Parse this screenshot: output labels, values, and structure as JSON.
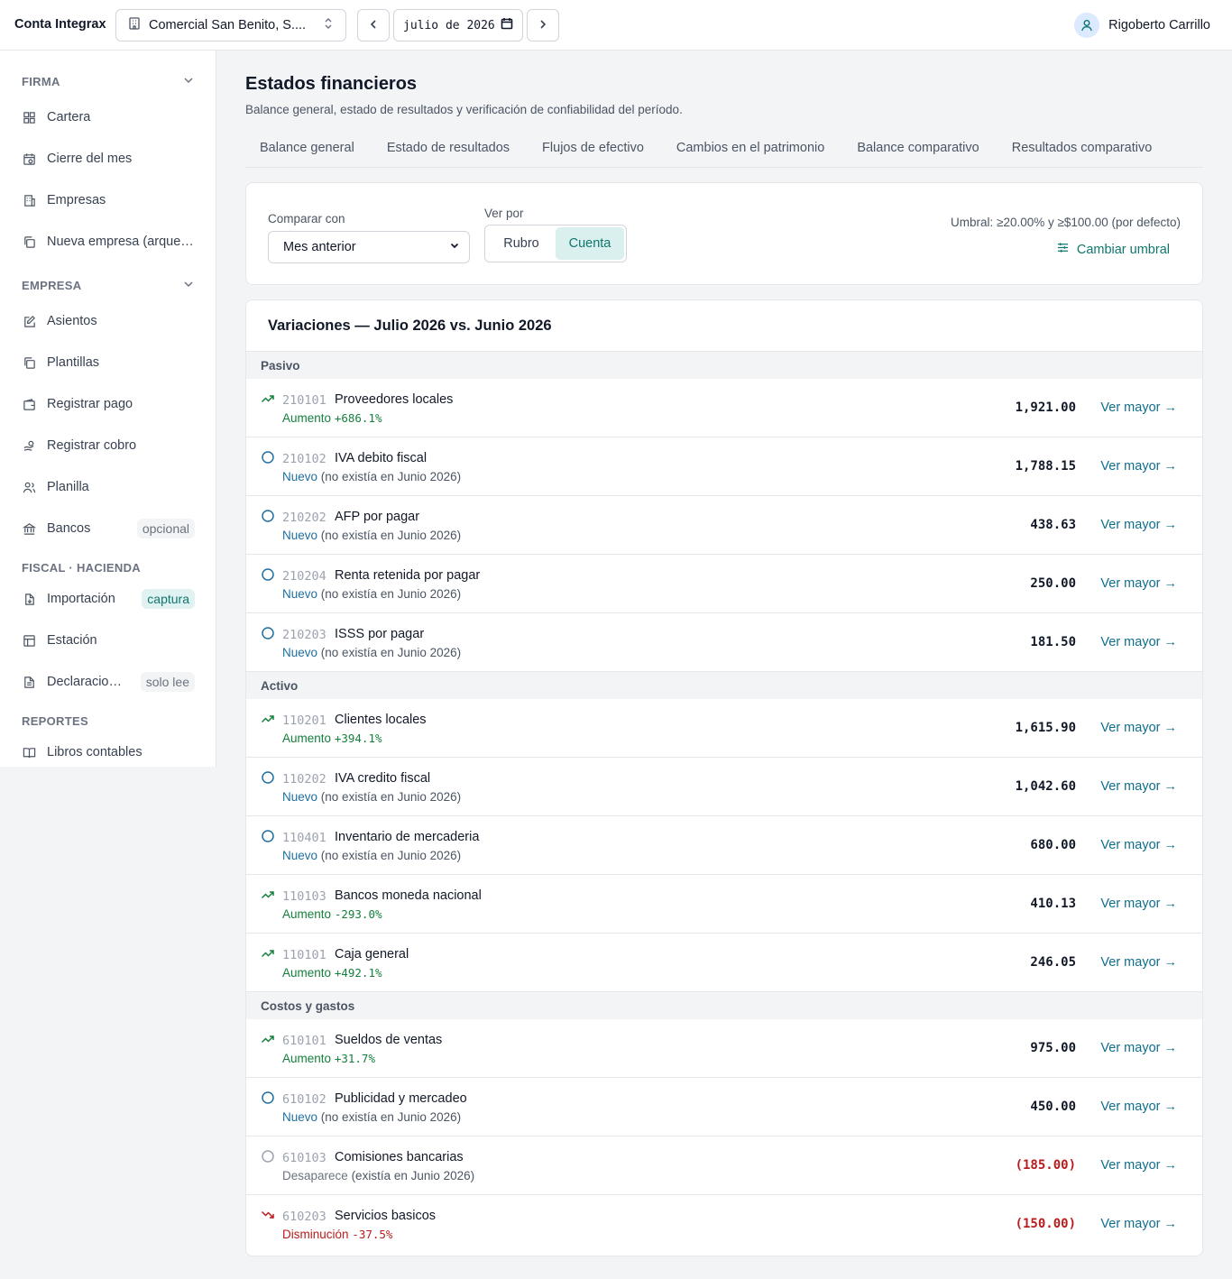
{
  "app": {
    "brand": "Conta Integrax"
  },
  "header": {
    "company": "Comercial San Benito, S....",
    "month_value": "julio de 2026",
    "user_name": "Rigoberto Carrillo"
  },
  "sidebar": {
    "sections": [
      {
        "title": "FIRMA",
        "items": [
          {
            "label": "Cartera",
            "icon": "grid-icon"
          },
          {
            "label": "Cierre del mes",
            "icon": "calendar-clock-icon"
          },
          {
            "label": "Empresas",
            "icon": "buildings-icon"
          },
          {
            "label": "Nueva empresa (arque…",
            "icon": "copy-icon"
          }
        ]
      },
      {
        "title": "EMPRESA",
        "items": [
          {
            "label": "Asientos",
            "icon": "edit-icon"
          },
          {
            "label": "Plantillas",
            "icon": "copy-icon"
          },
          {
            "label": "Registrar pago",
            "icon": "wallet-icon"
          },
          {
            "label": "Registrar cobro",
            "icon": "hand-coins-icon"
          },
          {
            "label": "Planilla",
            "icon": "users-icon"
          },
          {
            "label": "Bancos",
            "icon": "bank-icon",
            "badge": "opcional"
          }
        ]
      },
      {
        "title": "FISCAL · HACIENDA",
        "items": [
          {
            "label": "Importación",
            "icon": "file-import-icon",
            "badge": "captura"
          },
          {
            "label": "Estación",
            "icon": "table-icon"
          },
          {
            "label": "Declaracio…",
            "icon": "file-text-icon",
            "badge": "solo lee"
          }
        ]
      },
      {
        "title": "REPORTES",
        "items": [
          {
            "label": "Libros contables",
            "icon": "book-icon"
          }
        ]
      }
    ]
  },
  "page": {
    "title": "Estados financieros",
    "subtitle": "Balance general, estado de resultados y verificación de confiabilidad del período.",
    "tabs": [
      "Balance general",
      "Estado de resultados",
      "Flujos de efectivo",
      "Cambios en el patrimonio",
      "Balance comparativo",
      "Resultados comparativo"
    ]
  },
  "filters": {
    "compare_label": "Comparar con",
    "compare_value": "Mes anterior",
    "view_label": "Ver por",
    "view_options": [
      "Rubro",
      "Cuenta"
    ],
    "view_selected": "Cuenta",
    "threshold_text": "Umbral: ≥20.00% y ≥$100.00 (por defecto)",
    "threshold_button": "Cambiar umbral"
  },
  "variations": {
    "title": "Variaciones — Julio 2026 vs. Junio 2026",
    "link_label": "Ver mayor →",
    "groups": [
      {
        "name": "Pasivo",
        "rows": [
          {
            "code": "210101",
            "name": "Proveedores locales",
            "kind": "Aumento",
            "pct": "+686.1%",
            "amount": "1,921.00"
          },
          {
            "code": "210102",
            "name": "IVA debito fiscal",
            "kind": "Nuevo",
            "rest": "(no existía en Junio 2026)",
            "amount": "1,788.15"
          },
          {
            "code": "210202",
            "name": "AFP por pagar",
            "kind": "Nuevo",
            "rest": "(no existía en Junio 2026)",
            "amount": "438.63"
          },
          {
            "code": "210204",
            "name": "Renta retenida por pagar",
            "kind": "Nuevo",
            "rest": "(no existía en Junio 2026)",
            "amount": "250.00"
          },
          {
            "code": "210203",
            "name": "ISSS por pagar",
            "kind": "Nuevo",
            "rest": "(no existía en Junio 2026)",
            "amount": "181.50"
          }
        ]
      },
      {
        "name": "Activo",
        "rows": [
          {
            "code": "110201",
            "name": "Clientes locales",
            "kind": "Aumento",
            "pct": "+394.1%",
            "amount": "1,615.90"
          },
          {
            "code": "110202",
            "name": "IVA credito fiscal",
            "kind": "Nuevo",
            "rest": "(no existía en Junio 2026)",
            "amount": "1,042.60"
          },
          {
            "code": "110401",
            "name": "Inventario de mercaderia",
            "kind": "Nuevo",
            "rest": "(no existía en Junio 2026)",
            "amount": "680.00"
          },
          {
            "code": "110103",
            "name": "Bancos moneda nacional",
            "kind": "Aumento",
            "pct": "-293.0%",
            "amount": "410.13"
          },
          {
            "code": "110101",
            "name": "Caja general",
            "kind": "Aumento",
            "pct": "+492.1%",
            "amount": "246.05"
          }
        ]
      },
      {
        "name": "Costos y gastos",
        "rows": [
          {
            "code": "610101",
            "name": "Sueldos de ventas",
            "kind": "Aumento",
            "pct": "+31.7%",
            "amount": "975.00"
          },
          {
            "code": "610102",
            "name": "Publicidad y mercadeo",
            "kind": "Nuevo",
            "rest": "(no existía en Junio 2026)",
            "amount": "450.00"
          },
          {
            "code": "610103",
            "name": "Comisiones bancarias",
            "kind": "Desaparece",
            "rest": "(existía en Junio 2026)",
            "amount": "(185.00)"
          },
          {
            "code": "610203",
            "name": "Servicios basicos",
            "kind": "Disminución",
            "pct": "-37.5%",
            "amount": "(150.00)"
          }
        ]
      }
    ]
  }
}
